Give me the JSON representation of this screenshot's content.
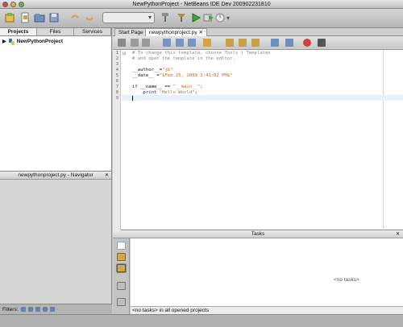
{
  "window": {
    "title": "NewPythonProject - NetBeans IDE Dev 200902231810"
  },
  "left": {
    "tabs": [
      {
        "label": "Projects"
      },
      {
        "label": "Files"
      },
      {
        "label": "Services"
      }
    ],
    "project_name": "NewPythonProject",
    "navigator_title": "newpythonproject.py - Navigator",
    "filters_label": "Filters:"
  },
  "editor": {
    "tabs": [
      {
        "label": "Start Page"
      },
      {
        "label": "newpythonproject.py"
      }
    ],
    "line_numbers": [
      "1",
      "2",
      "3",
      "4",
      "5",
      "6",
      "7",
      "8",
      "9"
    ],
    "lines": {
      "l1": "# To change this template, choose Tools | Templates",
      "l2": "# and open the template in the editor.",
      "l4a": "__author__",
      "l4b": "=",
      "l4c": "\"jb\"",
      "l5a": "__date__",
      "l5b": " =",
      "l5c": "\"$Feb 25, 2009 3:41:02 PM$\"",
      "l7a": "if",
      "l7b": " __name__ == ",
      "l7c": "\"__main__\"",
      "l7d": ":",
      "l8a": "    print",
      "l8b": " ",
      "l8c": "\"Hello World\"",
      "l8d": ";"
    }
  },
  "tasks": {
    "title": "Tasks",
    "empty_center": "<no tasks>",
    "status_prefix": "<no tasks>",
    "status_suffix": " in all opened projects"
  },
  "colors": {
    "comment": "#8a8a8a",
    "keyword": "#1b22a8",
    "string": "#c86a1c"
  },
  "icons": [
    "new-file-icon",
    "open-project-icon",
    "save-icon",
    "build-icon",
    "clean-build-icon",
    "run-icon",
    "debug-icon",
    "profile-icon"
  ]
}
